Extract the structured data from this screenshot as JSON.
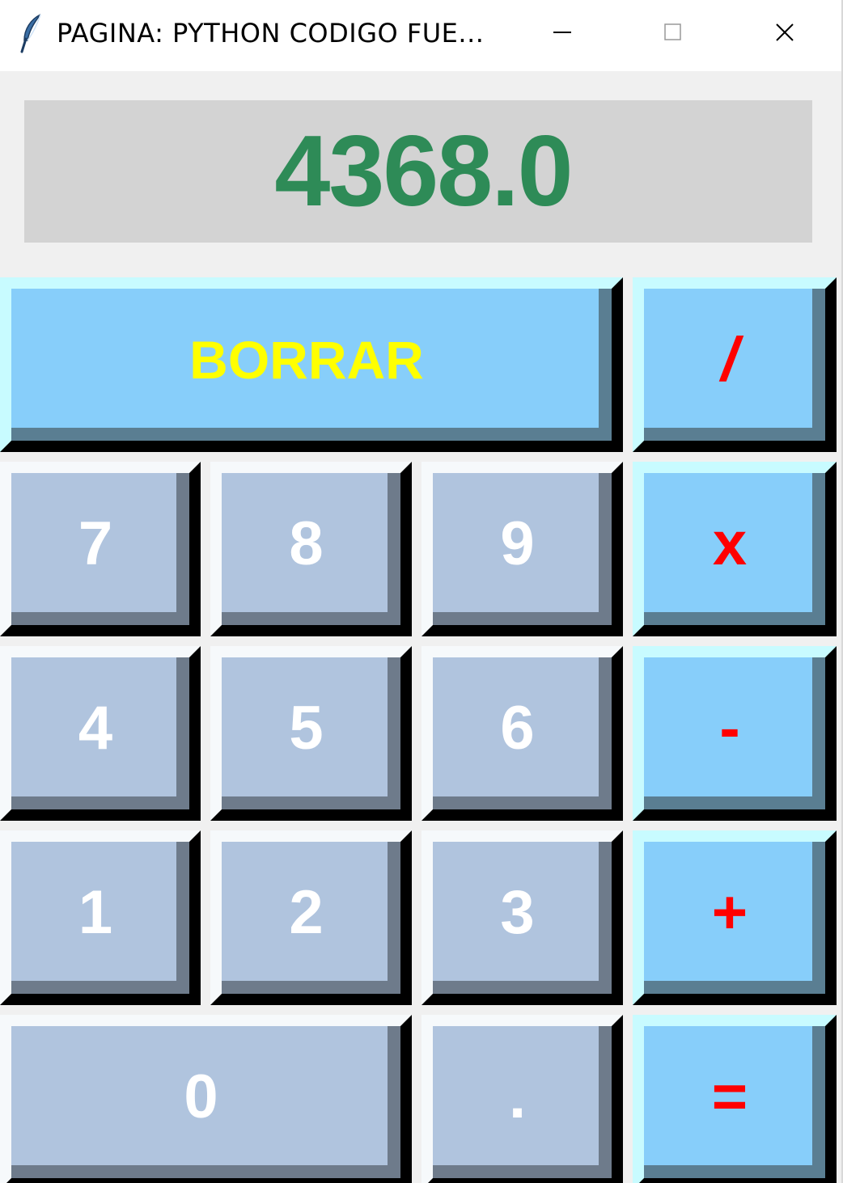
{
  "window": {
    "title": "PAGINA:  PYTHON  CODIGO  FUE..."
  },
  "display": {
    "value": "4368.0",
    "color": "#2e8b57",
    "background": "#d3d3d3"
  },
  "buttons": {
    "clear": "BORRAR",
    "divide": "/",
    "multiply": "x",
    "subtract": "-",
    "add": "+",
    "equals": "=",
    "decimal": ".",
    "digits": {
      "d0": "0",
      "d1": "1",
      "d2": "2",
      "d3": "3",
      "d4": "4",
      "d5": "5",
      "d6": "6",
      "d7": "7",
      "d8": "8",
      "d9": "9"
    }
  },
  "colors": {
    "digit_button_bg": "#b0c4de",
    "operator_button_bg": "#87cefa",
    "digit_text": "#ffffff",
    "operator_text": "#ff0000",
    "clear_text": "#ffff00"
  },
  "icons": {
    "app": "feather-icon",
    "minimize": "minimize-icon",
    "maximize": "maximize-icon",
    "close": "close-icon"
  }
}
